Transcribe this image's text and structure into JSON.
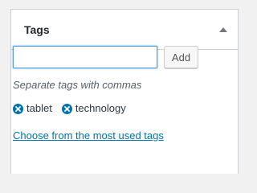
{
  "panel": {
    "title": "Tags",
    "toggle_icon": "triangle-up-icon"
  },
  "input": {
    "value": "",
    "placeholder": ""
  },
  "add_button": {
    "label": "Add"
  },
  "hint": "Separate tags with commas",
  "tags": [
    {
      "label": "tablet",
      "remove_icon": "remove-circle-x-icon"
    },
    {
      "label": "technology",
      "remove_icon": "remove-circle-x-icon"
    }
  ],
  "most_used_link": "Choose from the most used tags",
  "colors": {
    "remove_icon": "#0073aa",
    "link": "#0073aa",
    "input_focus_border": "#5b9dd9"
  }
}
